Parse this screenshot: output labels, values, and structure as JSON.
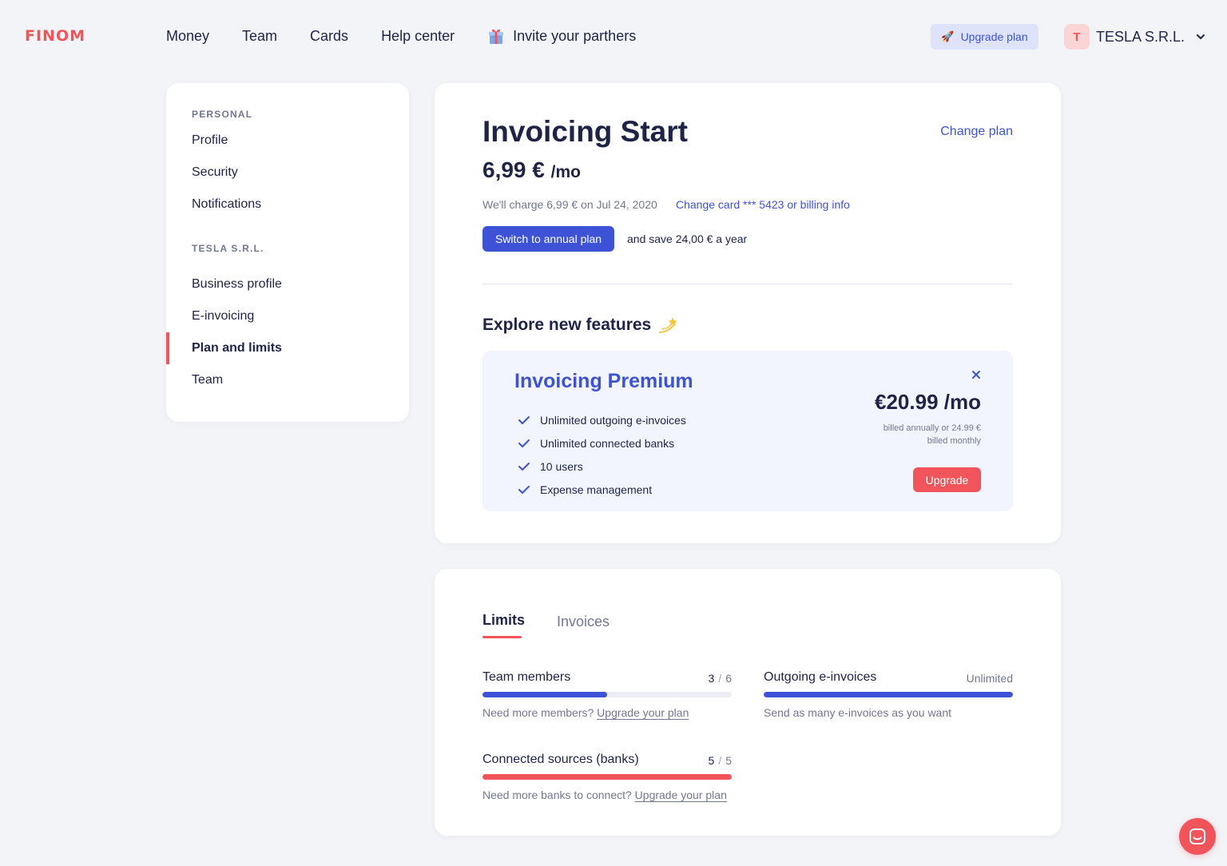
{
  "header": {
    "logo": "FINOM",
    "nav": [
      "Money",
      "Team",
      "Cards",
      "Help center"
    ],
    "invite_label": "Invite your parthers",
    "upgrade_label": "Upgrade plan",
    "avatar_letter": "T",
    "account_name": "TESLA S.R.L."
  },
  "sidebar": {
    "personal_heading": "PERSONAL",
    "personal_items": [
      "Profile",
      "Security",
      "Notifications"
    ],
    "company_heading": "TESLA S.R.L.",
    "company_items": [
      "Business profile",
      "E-invoicing",
      "Plan and limits",
      "Team"
    ],
    "active_item": "Plan and limits"
  },
  "plan": {
    "title": "Invoicing Start",
    "price": "6,99 €",
    "per": "/mo",
    "change_plan": "Change plan",
    "charge_line": "We'll charge 6,99 € on Jul  24, 2020",
    "change_card": "Change card *** 5423  or billing info",
    "switch_button": "Switch to annual plan",
    "save_text": "and save 24,00 € a year",
    "explore_heading": "Explore new features"
  },
  "premium": {
    "title": "Invoicing Premium",
    "features": [
      "Unlimited outgoing e-invoices",
      "Unlimited connected banks",
      "10 users",
      "Expense management"
    ],
    "price": "€20.99 /mo",
    "billing_note": "billed annually or 24.99 € billed monthly",
    "upgrade_button": "Upgrade"
  },
  "limits": {
    "tabs": [
      "Limits",
      "Invoices"
    ],
    "active_tab": "Limits",
    "items": [
      {
        "label": "Team members",
        "used": "3",
        "total": "6",
        "fraction": 0.5,
        "color": "#3d52d6",
        "note": "Need more members?",
        "link": "Upgrade your plan"
      },
      {
        "label": "Outgoing e-invoices",
        "status": "Unlimited",
        "fraction": 1,
        "color": "#3d52d6",
        "note": "Send as many e-invoices as you want"
      },
      {
        "label": "Connected sources (banks)",
        "used": "5",
        "total": "5",
        "fraction": 1,
        "color": "#f2545b",
        "note": "Need more banks to connect?",
        "link": "Upgrade your plan"
      }
    ]
  },
  "colors": {
    "accent": "#3d52d6",
    "brand": "#f2545b",
    "text": "#1f2447",
    "muted": "#737890"
  }
}
